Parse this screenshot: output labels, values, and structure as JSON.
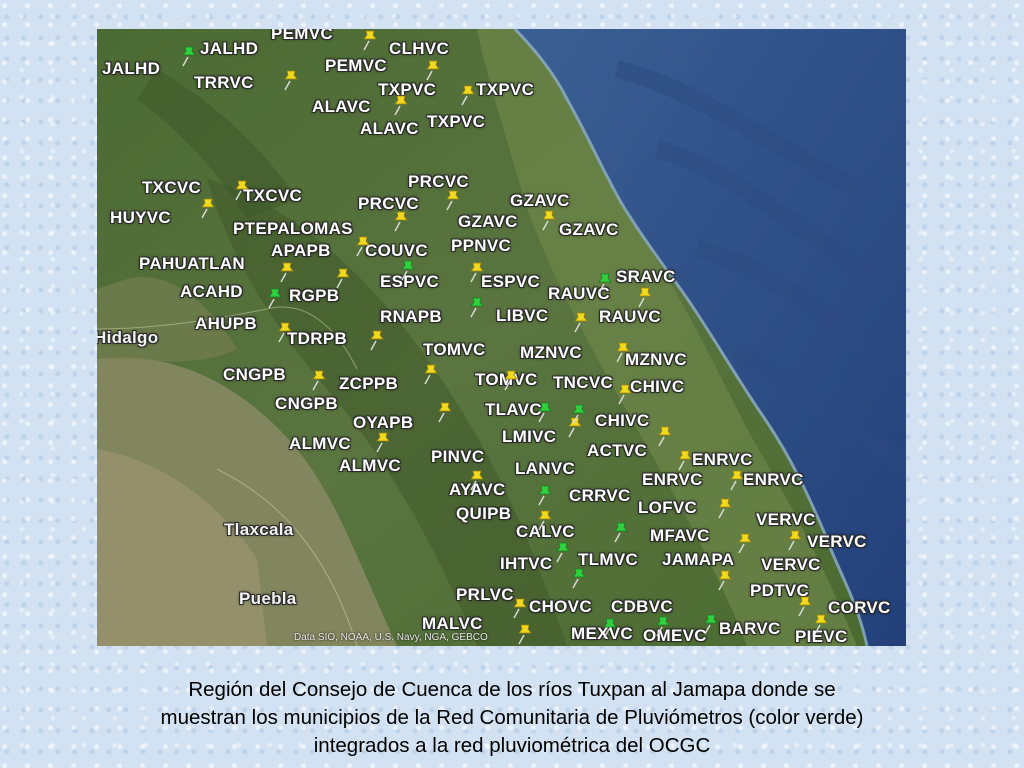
{
  "map": {
    "attribution": "Data SIO, NOAA, U.S. Navy, NGA, GEBCO",
    "colors": {
      "rain_gauge_pin": "#2fd13c",
      "station_pin": "#f2d81e",
      "sea": "#2f4f86",
      "land": "#55703a"
    },
    "places": [
      {
        "name": "Hidalgo"
      },
      {
        "name": "Tlaxcala"
      },
      {
        "name": "Puebla"
      }
    ],
    "station_labels": [
      "JALHD",
      "JALHD",
      "PEMVC",
      "PEMVC",
      "CLHVC",
      "TRRVC",
      "TXPVC",
      "TXPVC",
      "ALAVC",
      "ALAVC",
      "TXPVC",
      "TXCVC",
      "TXCVC",
      "HUYVC",
      "PRCVC",
      "PRCVC",
      "GZAVC",
      "GZAVC",
      "GZAVC",
      "PTEPALOMAS",
      "APAPB",
      "COUVC",
      "PPNVC",
      "PAHUATLAN",
      "ESPVC",
      "ESPVC",
      "SRAVC",
      "ACAHD",
      "RGPB",
      "RAUVC",
      "RNAPB",
      "LIBVC",
      "RAUVC",
      "AHUPB",
      "TDRPB",
      "TOMVC",
      "MZNVC",
      "MZNVC",
      "CNGPB",
      "ZCPPB",
      "TOMVC",
      "TNCVC",
      "CHIVC",
      "CNGPB",
      "TLAVC",
      "CHIVC",
      "OYAPB",
      "LMIVC",
      "ACTVC",
      "ALMVC",
      "PINVC",
      "ENRVC",
      "ALMVC",
      "LANVC",
      "ENRVC",
      "ENRVC",
      "AYAVC",
      "CRRVC",
      "LOFVC",
      "QUIPB",
      "VERVC",
      "CALVC",
      "MFAVC",
      "VERVC",
      "IHTVC",
      "TLMVC",
      "JAMAPA",
      "VERVC",
      "PDTVC",
      "PRLVC",
      "CORVC",
      "CHOVC",
      "CDBVC",
      "MALVC",
      "MEXVC",
      "OMEVC",
      "BARVC",
      "PIEVC"
    ],
    "pins": [
      {
        "color": "green"
      },
      {
        "color": "yellow"
      },
      {
        "color": "yellow"
      },
      {
        "color": "yellow"
      },
      {
        "color": "yellow"
      },
      {
        "color": "yellow"
      },
      {
        "color": "yellow"
      },
      {
        "color": "yellow"
      },
      {
        "color": "yellow"
      },
      {
        "color": "yellow"
      },
      {
        "color": "yellow"
      },
      {
        "color": "yellow"
      },
      {
        "color": "yellow"
      },
      {
        "color": "yellow"
      },
      {
        "color": "yellow"
      },
      {
        "color": "green"
      },
      {
        "color": "yellow"
      },
      {
        "color": "green"
      },
      {
        "color": "yellow"
      },
      {
        "color": "green"
      },
      {
        "color": "yellow"
      },
      {
        "color": "yellow"
      },
      {
        "color": "yellow"
      },
      {
        "color": "yellow"
      },
      {
        "color": "yellow"
      },
      {
        "color": "yellow"
      },
      {
        "color": "yellow"
      },
      {
        "color": "yellow"
      },
      {
        "color": "yellow"
      },
      {
        "color": "yellow"
      },
      {
        "color": "yellow"
      },
      {
        "color": "yellow"
      },
      {
        "color": "green"
      },
      {
        "color": "green"
      },
      {
        "color": "yellow"
      },
      {
        "color": "yellow"
      },
      {
        "color": "yellow"
      },
      {
        "color": "yellow"
      },
      {
        "color": "green"
      },
      {
        "color": "yellow"
      },
      {
        "color": "yellow"
      },
      {
        "color": "green"
      },
      {
        "color": "yellow"
      },
      {
        "color": "green"
      },
      {
        "color": "green"
      },
      {
        "color": "yellow"
      },
      {
        "color": "green"
      },
      {
        "color": "green"
      },
      {
        "color": "yellow"
      },
      {
        "color": "yellow"
      },
      {
        "color": "yellow"
      },
      {
        "color": "green"
      },
      {
        "color": "green"
      },
      {
        "color": "yellow"
      },
      {
        "color": "yellow"
      }
    ]
  },
  "caption": {
    "line1": "Región del Consejo de Cuenca de los ríos Tuxpan al Jamapa donde se",
    "line2": "muestran los municipios de la Red Comunitaria de Pluviómetros (color verde)",
    "line3": "integrados a la red pluviométrica del OCGC"
  }
}
